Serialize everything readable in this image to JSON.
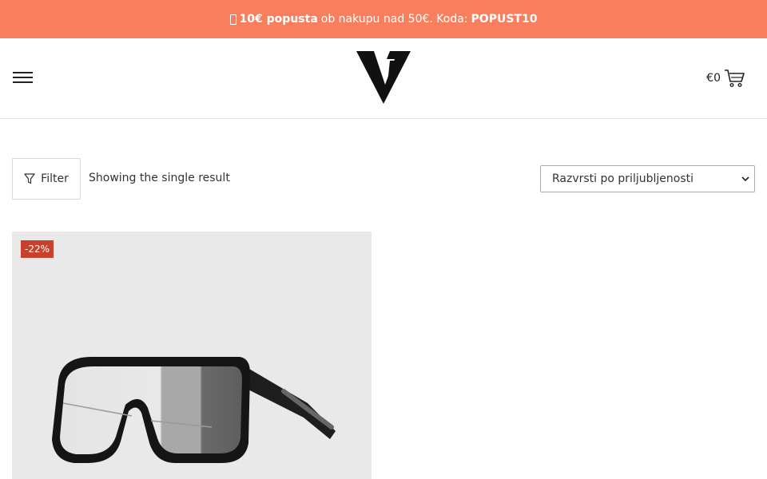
{
  "promo": {
    "emoji": "🎁",
    "bold_amount": "10€ popusta",
    "middle_text": "ob nakupu nad 50€. Koda:",
    "code": "POPUST10"
  },
  "header": {
    "cart_amount": "€0",
    "logo_icon": "v7-logo"
  },
  "toolbar": {
    "filter_label": "Filter",
    "result_text": "Showing the single result",
    "sort_selected": "Razvrsti po priljubljenosti"
  },
  "products": [
    {
      "badge": "-22%",
      "image_icon": "sunglasses-image"
    }
  ],
  "colors": {
    "promo_bg": "#f77f5e",
    "badge_bg": "#c9402c",
    "card_bg": "#e9e9e9"
  }
}
